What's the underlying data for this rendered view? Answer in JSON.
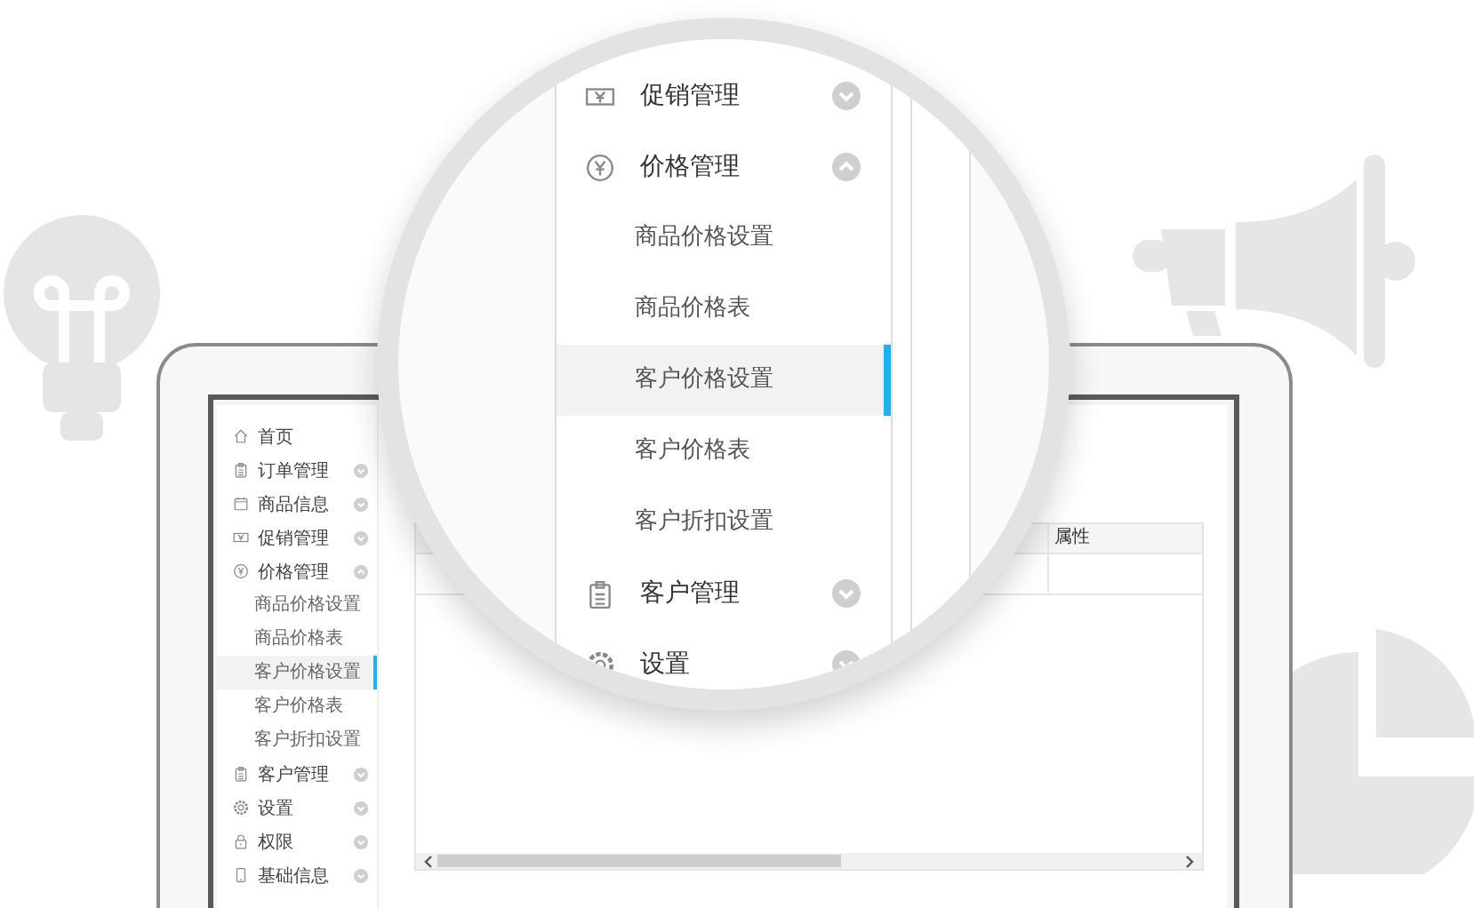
{
  "screen_sidebar": {
    "items": [
      {
        "label": "首页"
      },
      {
        "label": "订单管理",
        "expanded": false
      },
      {
        "label": "商品信息",
        "expanded": false
      },
      {
        "label": "促销管理",
        "expanded": false
      },
      {
        "label": "价格管理",
        "expanded": true,
        "children": [
          {
            "label": "商品价格设置",
            "selected": false
          },
          {
            "label": "商品价格表",
            "selected": false
          },
          {
            "label": "客户价格设置",
            "selected": true
          },
          {
            "label": "客户价格表",
            "selected": false
          },
          {
            "label": "客户折扣设置",
            "selected": false
          }
        ]
      },
      {
        "label": "客户管理",
        "expanded": false
      },
      {
        "label": "设置",
        "expanded": false
      },
      {
        "label": "权限",
        "expanded": false
      },
      {
        "label": "基础信息",
        "expanded": false
      }
    ]
  },
  "table": {
    "columns": [
      "属性"
    ]
  },
  "magnifier": {
    "items": [
      {
        "label": "促销管理",
        "expanded": false
      },
      {
        "label": "价格管理",
        "expanded": true,
        "children": [
          {
            "label": "商品价格设置",
            "selected": false
          },
          {
            "label": "商品价格表",
            "selected": false
          },
          {
            "label": "客户价格设置",
            "selected": true
          },
          {
            "label": "客户价格表",
            "selected": false
          },
          {
            "label": "客户折扣设置",
            "selected": false
          }
        ]
      },
      {
        "label": "客户管理",
        "expanded": false
      },
      {
        "label": "设置",
        "expanded": false
      }
    ]
  }
}
